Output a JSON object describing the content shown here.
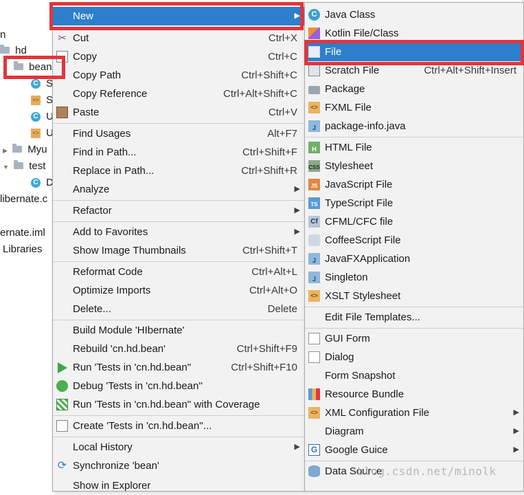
{
  "tree": {
    "rows": [
      {
        "label": "n",
        "icon": "none"
      },
      {
        "label": "hd",
        "icon": "folder"
      },
      {
        "label": "bean",
        "icon": "folder"
      },
      {
        "label": "S",
        "icon": "class"
      },
      {
        "label": "S",
        "icon": "xml"
      },
      {
        "label": "U",
        "icon": "class"
      },
      {
        "label": "U",
        "icon": "xml"
      },
      {
        "label": "Myu",
        "icon": "folder"
      },
      {
        "label": "test",
        "icon": "folder"
      },
      {
        "label": "D",
        "icon": "class"
      },
      {
        "label": "libernate.c",
        "icon": "none"
      },
      {
        "label": "ernate.iml",
        "icon": "none"
      },
      {
        "label": "Libraries",
        "icon": "none"
      }
    ]
  },
  "main_menu": {
    "items": [
      {
        "label": "New",
        "shortcut": "",
        "submenu": true,
        "icon": "none",
        "selected": true
      },
      {
        "label": "Cut",
        "shortcut": "Ctrl+X",
        "icon": "scissors-icon"
      },
      {
        "label": "Copy",
        "shortcut": "Ctrl+C",
        "icon": "copy-icon"
      },
      {
        "label": "Copy Path",
        "shortcut": "Ctrl+Shift+C",
        "icon": "none"
      },
      {
        "label": "Copy Reference",
        "shortcut": "Ctrl+Alt+Shift+C",
        "icon": "none"
      },
      {
        "label": "Paste",
        "shortcut": "Ctrl+V",
        "icon": "paste-icon"
      },
      {
        "label": "Find Usages",
        "shortcut": "Alt+F7",
        "icon": "none"
      },
      {
        "label": "Find in Path...",
        "shortcut": "Ctrl+Shift+F",
        "icon": "none"
      },
      {
        "label": "Replace in Path...",
        "shortcut": "Ctrl+Shift+R",
        "icon": "none"
      },
      {
        "label": "Analyze",
        "shortcut": "",
        "submenu": true,
        "icon": "none"
      },
      {
        "label": "Refactor",
        "shortcut": "",
        "submenu": true,
        "icon": "none"
      },
      {
        "label": "Add to Favorites",
        "shortcut": "",
        "submenu": true,
        "icon": "none"
      },
      {
        "label": "Show Image Thumbnails",
        "shortcut": "Ctrl+Shift+T",
        "icon": "none"
      },
      {
        "label": "Reformat Code",
        "shortcut": "Ctrl+Alt+L",
        "icon": "none"
      },
      {
        "label": "Optimize Imports",
        "shortcut": "Ctrl+Alt+O",
        "icon": "none"
      },
      {
        "label": "Delete...",
        "shortcut": "Delete",
        "icon": "none"
      },
      {
        "label": "Build Module 'HIbernate'",
        "shortcut": "",
        "icon": "none"
      },
      {
        "label": "Rebuild 'cn.hd.bean'",
        "shortcut": "Ctrl+Shift+F9",
        "icon": "none"
      },
      {
        "label": "Run 'Tests in 'cn.hd.bean''",
        "shortcut": "Ctrl+Shift+F10",
        "icon": "run-icon"
      },
      {
        "label": "Debug 'Tests in 'cn.hd.bean''",
        "shortcut": "",
        "icon": "debug-icon"
      },
      {
        "label": "Run 'Tests in 'cn.hd.bean'' with Coverage",
        "shortcut": "",
        "icon": "coverage-icon"
      },
      {
        "label": "Create 'Tests in 'cn.hd.bean''...",
        "shortcut": "",
        "icon": "create-test-icon"
      },
      {
        "label": "Local History",
        "shortcut": "",
        "submenu": true,
        "icon": "none"
      },
      {
        "label": "Synchronize 'bean'",
        "shortcut": "",
        "icon": "sync-icon"
      },
      {
        "label": "Show in Explorer",
        "shortcut": "",
        "icon": "none"
      }
    ]
  },
  "sub_menu": {
    "items": [
      {
        "label": "Java Class",
        "shortcut": "",
        "icon": "java-class-icon"
      },
      {
        "label": "Kotlin File/Class",
        "shortcut": "",
        "icon": "kotlin-icon"
      },
      {
        "label": "File",
        "shortcut": "",
        "icon": "file-icon",
        "selected": true
      },
      {
        "label": "Scratch File",
        "shortcut": "Ctrl+Alt+Shift+Insert",
        "icon": "scratch-file-icon"
      },
      {
        "label": "Package",
        "shortcut": "",
        "icon": "package-icon"
      },
      {
        "label": "FXML File",
        "shortcut": "",
        "icon": "fxml-icon"
      },
      {
        "label": "package-info.java",
        "shortcut": "",
        "icon": "java-file-icon"
      },
      {
        "label": "HTML File",
        "shortcut": "",
        "icon": "html-icon"
      },
      {
        "label": "Stylesheet",
        "shortcut": "",
        "icon": "css-icon"
      },
      {
        "label": "JavaScript File",
        "shortcut": "",
        "icon": "js-icon"
      },
      {
        "label": "TypeScript File",
        "shortcut": "",
        "icon": "ts-icon"
      },
      {
        "label": "CFML/CFC file",
        "shortcut": "",
        "icon": "cfml-icon"
      },
      {
        "label": "CoffeeScript File",
        "shortcut": "",
        "icon": "coffee-icon"
      },
      {
        "label": "JavaFXApplication",
        "shortcut": "",
        "icon": "javafx-icon"
      },
      {
        "label": "Singleton",
        "shortcut": "",
        "icon": "singleton-icon"
      },
      {
        "label": "XSLT Stylesheet",
        "shortcut": "",
        "icon": "xslt-icon"
      },
      {
        "label": "Edit File Templates...",
        "shortcut": "",
        "icon": "none"
      },
      {
        "label": "GUI Form",
        "shortcut": "",
        "icon": "gui-form-icon"
      },
      {
        "label": "Dialog",
        "shortcut": "",
        "icon": "dialog-icon"
      },
      {
        "label": "Form Snapshot",
        "shortcut": "",
        "icon": "none"
      },
      {
        "label": "Resource Bundle",
        "shortcut": "",
        "icon": "resource-bundle-icon"
      },
      {
        "label": "XML Configuration File",
        "shortcut": "",
        "submenu": true,
        "icon": "xml-config-icon"
      },
      {
        "label": "Diagram",
        "shortcut": "",
        "submenu": true,
        "icon": "none"
      },
      {
        "label": "Google Guice",
        "shortcut": "",
        "submenu": true,
        "icon": "google-guice-icon"
      },
      {
        "label": "Data Source",
        "shortcut": "",
        "icon": "data-source-icon"
      }
    ]
  },
  "watermark": "blog.csdn.net/minolk",
  "colors": {
    "selection": "#2d7fcb",
    "highlight_box": "#e4343b",
    "menu_bg": "#f2f2f2"
  }
}
